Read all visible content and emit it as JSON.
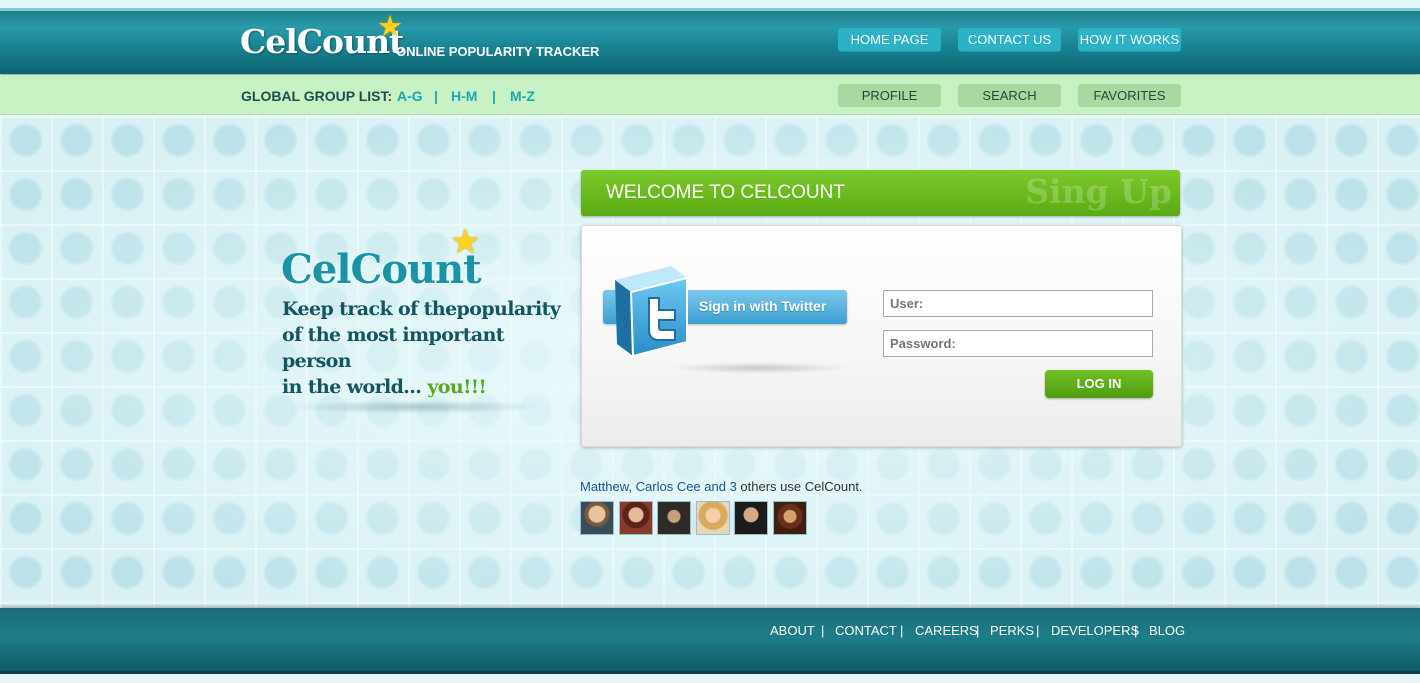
{
  "header": {
    "logo": "CelCount",
    "tagline": "ONLINE POPULARITY TRACKER",
    "nav": [
      "HOME PAGE",
      "CONTACT US",
      "HOW IT WORKS"
    ]
  },
  "subbar": {
    "group_label": "GLOBAL GROUP LIST:",
    "groups": [
      "A-G",
      "H-M",
      "M-Z"
    ],
    "separator": "|",
    "nav": [
      "PROFILE",
      "SEARCH",
      "FAVORITES"
    ]
  },
  "promo": {
    "logo": "CelCount",
    "line1": "Keep track of thepopularity",
    "line2": "of the most important person",
    "line3": "in the world...",
    "highlight": "you!!!"
  },
  "welcome": {
    "title": "WELCOME TO CELCOUNT",
    "ghost": "Sing Up"
  },
  "login": {
    "twitter_label": "Sign in with Twitter",
    "user_placeholder": "User:",
    "password_placeholder": "Password:",
    "button": "LOG IN"
  },
  "social": {
    "names": "Matthew, Carlos Cee and 3",
    "suffix": " others use CelCount."
  },
  "footer": {
    "links": [
      "ABOUT",
      "CONTACT",
      "CAREERS",
      "PERKS",
      "DEVELOPERS",
      "BLOG"
    ],
    "separator": "|"
  },
  "icons": [
    "star-icon",
    "twitter-bird-icon"
  ],
  "colors": {
    "header_teal": "#1a8696",
    "nav_button": "#2cb2c6",
    "subbar_green": "#c9f2c4",
    "accent_green": "#5aaa12",
    "twitter_blue": "#3b9fd2",
    "logo_teal": "#1a93a6"
  }
}
